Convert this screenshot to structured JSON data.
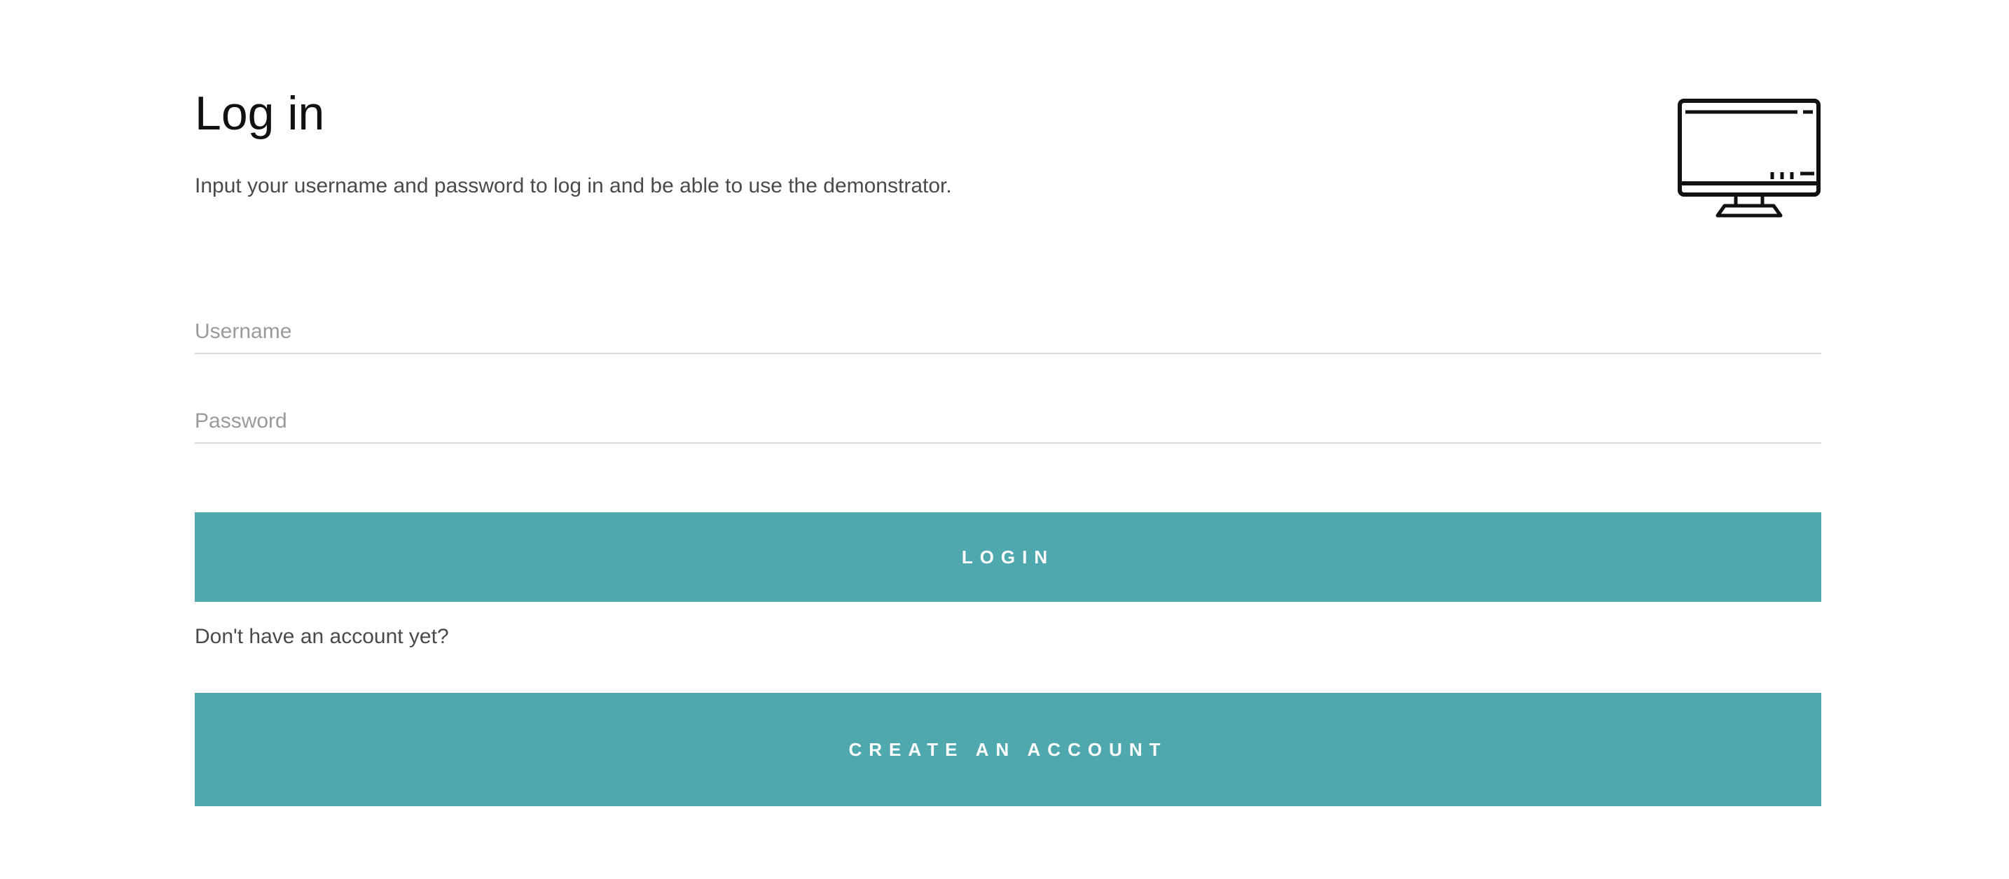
{
  "header": {
    "title": "Log in",
    "subtitle": "Input your username and password to log in and be able to use the demonstrator.",
    "icon": "monitor-icon"
  },
  "form": {
    "username_placeholder": "Username",
    "username_value": "",
    "password_placeholder": "Password",
    "password_value": "",
    "login_label": "Login"
  },
  "signup": {
    "prompt": "Don't have an account yet?",
    "create_label": "Create an account"
  },
  "colors": {
    "accent": "#50a8af",
    "text": "#4a4a4a",
    "placeholder": "#9a9a9a",
    "divider": "#dcdcdc"
  }
}
